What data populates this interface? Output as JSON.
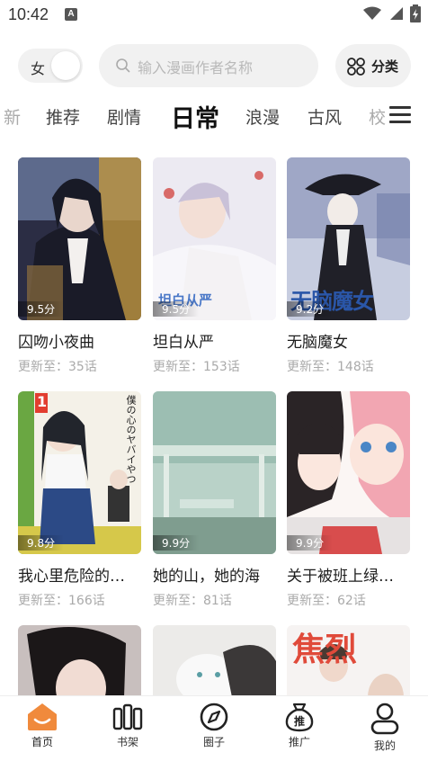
{
  "status": {
    "time": "10:42",
    "notif": "A"
  },
  "header": {
    "gender": "女",
    "search_placeholder": "输入漫画作者名称",
    "category_label": "分类"
  },
  "tabs": [
    "新",
    "推荐",
    "剧情",
    "日常",
    "浪漫",
    "古风",
    "校"
  ],
  "active_tab": "日常",
  "comics": [
    {
      "title": "囚吻小夜曲",
      "score": "9.5分",
      "update": "更新至：35话"
    },
    {
      "title": "坦白从严",
      "score": "9.5分",
      "update": "更新至：153话"
    },
    {
      "title": "无脑魔女",
      "score": "9.2分",
      "update": "更新至：148话"
    },
    {
      "title": "我心里危险的…",
      "score": "9.8分",
      "update": "更新至：166话"
    },
    {
      "title": "她的山，她的海",
      "score": "9.9分",
      "update": "更新至：81话"
    },
    {
      "title": "关于被班上绿…",
      "score": "9.9分",
      "update": "更新至：62话"
    }
  ],
  "cover_text": {
    "c2": "坦白从严",
    "c3": "无脑魔女",
    "c4_top": "僕の心のヤバイやつ",
    "c4_vol": "1",
    "c9": "焦烈"
  },
  "nav": [
    {
      "label": "首页",
      "icon": "home-icon"
    },
    {
      "label": "书架",
      "icon": "bookshelf-icon"
    },
    {
      "label": "圈子",
      "icon": "compass-icon"
    },
    {
      "label": "推广",
      "icon": "promo-bag-icon"
    },
    {
      "label": "我的",
      "icon": "profile-icon"
    }
  ],
  "colors": {
    "accent": "#f08a3c",
    "bg": "#ffffff",
    "chip": "#f1f1f1",
    "muted": "#aaaaaa"
  }
}
